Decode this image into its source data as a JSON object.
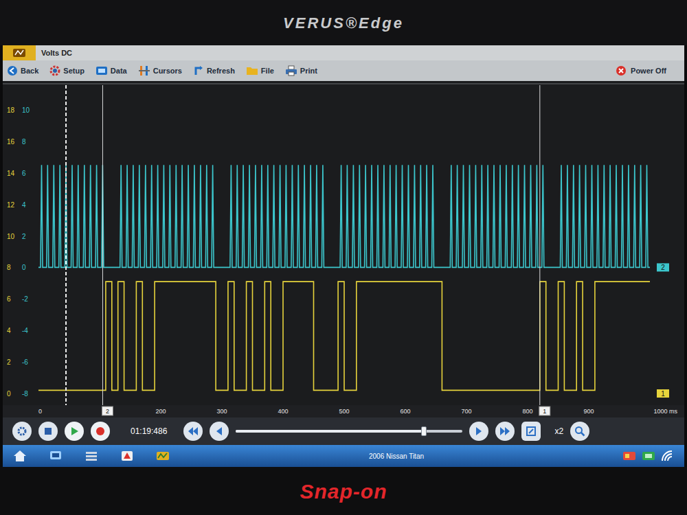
{
  "device": {
    "model": "VERUS®Edge",
    "brand": "Snap-on"
  },
  "header": {
    "title": "Volts DC"
  },
  "toolbar": [
    {
      "label": "Back"
    },
    {
      "label": "Setup"
    },
    {
      "label": "Data"
    },
    {
      "label": "Cursors"
    },
    {
      "label": "Refresh"
    },
    {
      "label": "File"
    },
    {
      "label": "Print"
    }
  ],
  "power_button": {
    "label": "Power Off"
  },
  "chart": {
    "x_ticks": [
      {
        "label": "0",
        "t": 0
      },
      {
        "label": "200",
        "t": 200
      },
      {
        "label": "300",
        "t": 300
      },
      {
        "label": "400",
        "t": 400
      },
      {
        "label": "500",
        "t": 500
      },
      {
        "label": "600",
        "t": 600
      },
      {
        "label": "700",
        "t": 700
      },
      {
        "label": "800",
        "t": 800
      },
      {
        "label": "900",
        "t": 900
      },
      {
        "label": "1000 ms",
        "t": 1000
      }
    ],
    "trigger_t": 45,
    "cursors": [
      {
        "label": "2",
        "t": 105
      },
      {
        "label": "1",
        "t": 820
      }
    ],
    "series": [
      {
        "marker": "1",
        "color": "#e6d33c",
        "kind": "step",
        "sample_ms": 10,
        "ticks": [
          "18",
          "16",
          "14",
          "12",
          "10",
          "8",
          "6",
          "4",
          "2",
          "0"
        ],
        "values": [
          0.2,
          0.2,
          0.2,
          0.2,
          0.2,
          0.2,
          0.2,
          0.2,
          0.2,
          0.2,
          0.2,
          7.1,
          0.2,
          7.1,
          0.2,
          0.2,
          7.1,
          0.2,
          0.2,
          7.1,
          7.1,
          7.1,
          7.1,
          7.1,
          7.1,
          7.1,
          7.1,
          7.1,
          7.1,
          0.2,
          0.2,
          7.1,
          0.2,
          0.2,
          7.1,
          0.2,
          0.2,
          7.1,
          0.2,
          0.2,
          7.1,
          7.1,
          7.1,
          7.1,
          7.1,
          0.2,
          0.2,
          0.2,
          0.2,
          7.1,
          0.2,
          0.2,
          7.1,
          7.1,
          7.1,
          7.1,
          7.1,
          7.1,
          7.1,
          7.1,
          7.1,
          7.1,
          7.1,
          7.1,
          7.1,
          7.1,
          0.2,
          0.2,
          0.2,
          0.2,
          0.2,
          0.2,
          0.2,
          0.2,
          0.2,
          0.2,
          0.2,
          0.2,
          0.2,
          0.2,
          0.2,
          0.2,
          7.1,
          0.2,
          0.2,
          7.1,
          0.2,
          0.2,
          7.1,
          0.2,
          0.2,
          7.1,
          7.1,
          7.1,
          7.1,
          7.1,
          7.1,
          7.1,
          7.1,
          7.1,
          7.1
        ]
      },
      {
        "marker": "2",
        "color": "#3cc6cc",
        "kind": "spikes",
        "sample_ms": 5,
        "ticks": [
          "10",
          "8",
          "6",
          "4",
          "2",
          "0",
          "-2",
          "-4",
          "-6",
          "-8"
        ],
        "values": [
          0,
          6.5,
          0,
          6.5,
          0,
          6.5,
          0,
          6.5,
          0,
          6.5,
          0,
          6.5,
          0,
          6.5,
          0,
          6.5,
          0,
          6.5,
          0,
          6.5,
          0,
          6.5,
          0,
          0,
          0,
          0,
          0,
          6.5,
          0,
          6.5,
          0,
          6.5,
          0,
          6.5,
          0,
          6.5,
          0,
          6.5,
          0,
          6.5,
          0,
          6.5,
          0,
          6.5,
          0,
          6.5,
          0,
          6.5,
          0,
          6.5,
          0,
          6.5,
          0,
          6.5,
          0,
          6.5,
          0,
          6.5,
          0,
          0,
          0,
          0,
          0,
          6.5,
          0,
          6.5,
          0,
          6.5,
          0,
          6.5,
          0,
          6.5,
          0,
          6.5,
          0,
          6.5,
          0,
          6.5,
          0,
          6.5,
          0,
          6.5,
          0,
          6.5,
          0,
          6.5,
          0,
          6.5,
          0,
          6.5,
          0,
          6.5,
          0,
          6.5,
          0,
          0,
          0,
          0,
          0,
          6.5,
          0,
          6.5,
          0,
          6.5,
          0,
          6.5,
          0,
          6.5,
          0,
          6.5,
          0,
          6.5,
          0,
          6.5,
          0,
          6.5,
          0,
          6.5,
          0,
          6.5,
          0,
          6.5,
          0,
          6.5,
          0,
          6.5,
          0,
          6.5,
          0,
          6.5,
          0,
          0,
          0,
          0,
          0,
          6.5,
          0,
          6.5,
          0,
          6.5,
          0,
          6.5,
          0,
          6.5,
          0,
          6.5,
          0,
          6.5,
          0,
          6.5,
          0,
          6.5,
          0,
          6.5,
          0,
          6.5,
          0,
          6.5,
          0,
          6.5,
          0,
          6.5,
          0,
          6.5,
          0,
          6.5,
          0,
          0,
          0,
          0,
          0,
          6.5,
          0,
          6.5,
          0,
          6.5,
          0,
          6.5,
          0,
          6.5,
          0,
          6.5,
          0,
          6.5,
          0,
          6.5,
          0,
          6.5,
          0,
          6.5,
          0,
          6.5,
          0,
          6.5,
          0,
          6.5,
          0,
          6.5,
          0,
          6.5,
          0
        ]
      }
    ]
  },
  "playback": {
    "time": "01:19:486",
    "level": 0.83,
    "zoom": "x2"
  },
  "taskbar": {
    "vehicle": "2006 Nissan Titan"
  }
}
